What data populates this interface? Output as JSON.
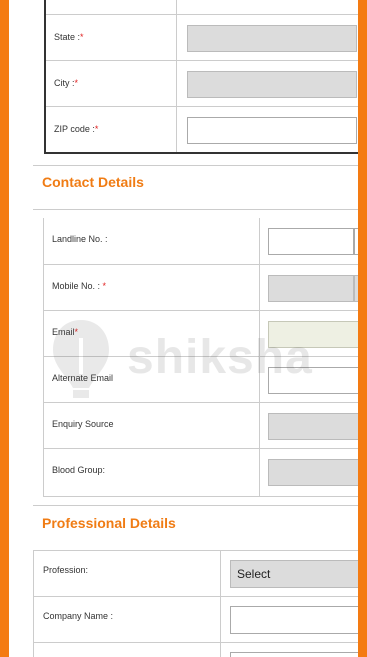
{
  "address": {
    "rows": [
      {
        "label": "State :",
        "required_mark": "*"
      },
      {
        "label": "City :",
        "required_mark": "*"
      },
      {
        "label": "ZIP code :",
        "required_mark": "*"
      }
    ]
  },
  "contact": {
    "title": "Contact Details",
    "rows": [
      {
        "label": "Landline No. :",
        "required_mark": ""
      },
      {
        "label": "Mobile No. :",
        "required_mark": " *"
      },
      {
        "label": "Email",
        "required_mark": "*"
      },
      {
        "label": "Alternate Email",
        "required_mark": ""
      },
      {
        "label": "Enquiry Source",
        "required_mark": ""
      },
      {
        "label": "Blood Group:",
        "required_mark": ""
      }
    ]
  },
  "professional": {
    "title": "Professional Details",
    "rows": [
      {
        "label": "Profession:",
        "value": "Select"
      },
      {
        "label": "Company Name :",
        "value": ""
      }
    ]
  },
  "watermark": {
    "text": "shiksha"
  },
  "colors": {
    "accent": "#f47b12",
    "heading": "#f07c14",
    "required": "#e02020",
    "disabled_field": "#dcdcdc"
  }
}
